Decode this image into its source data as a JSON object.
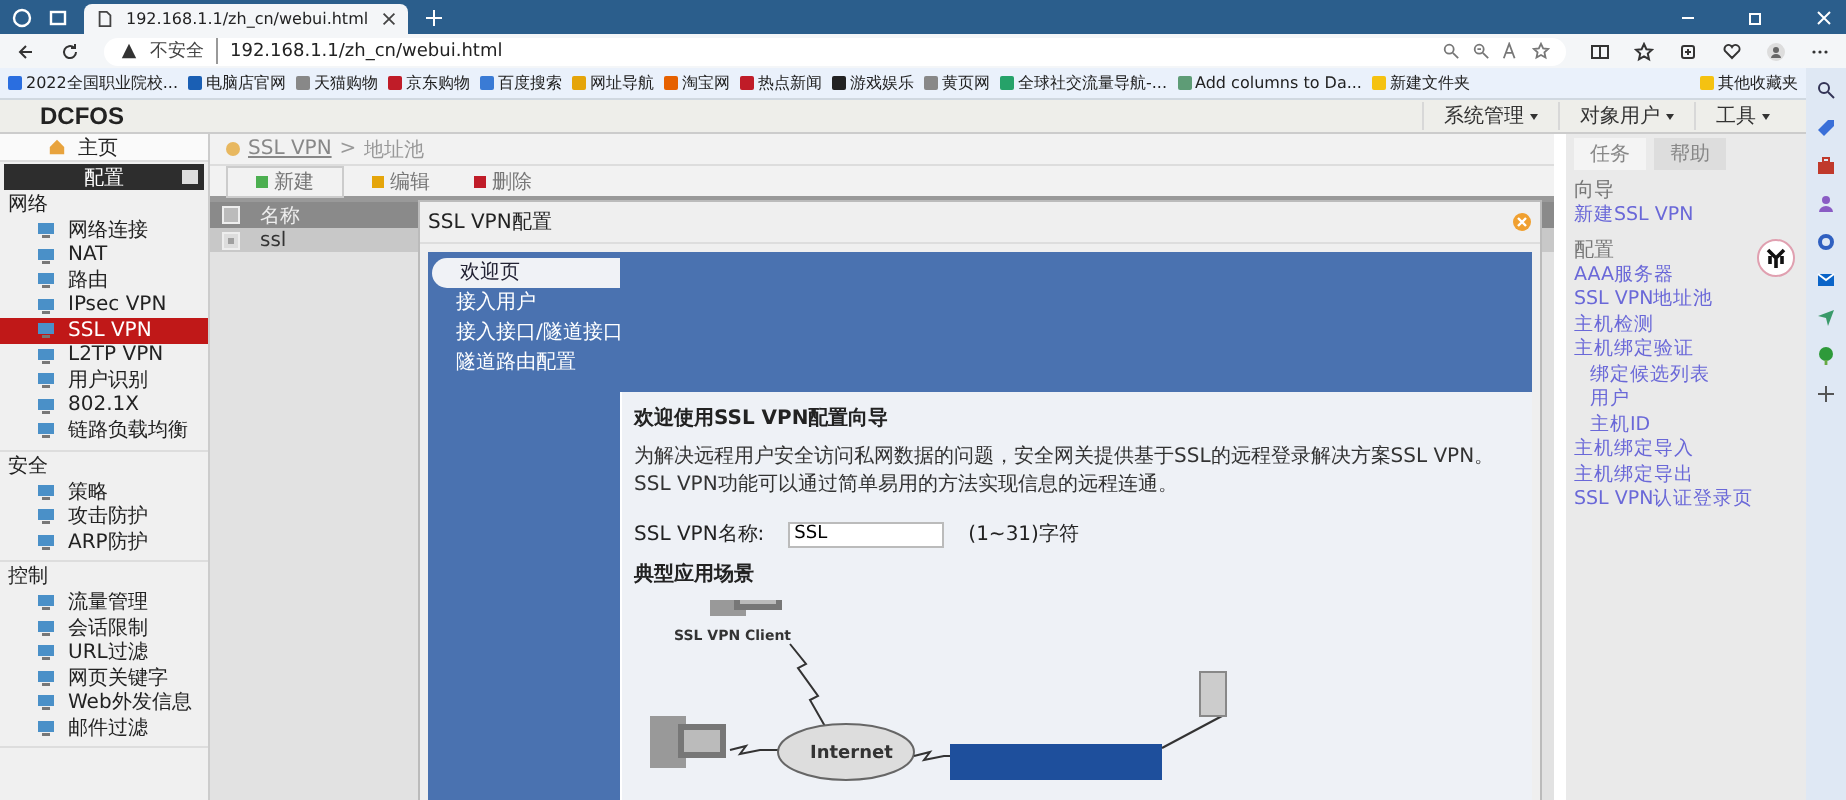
{
  "browser": {
    "tab_title": "192.168.1.1/zh_cn/webui.html",
    "security": "不安全",
    "url": "192.168.1.1/zh_cn/webui.html",
    "bookmarks": [
      "2022全国职业院校...",
      "电脑店官网",
      "天猫购物",
      "京东购物",
      "百度搜索",
      "网址导航",
      "淘宝网",
      "热点新闻",
      "游戏娱乐",
      "黄页网",
      "全球社交流量导航-...",
      "Add columns to Da...",
      "新建文件夹"
    ],
    "other_bookmarks": "其他收藏夹"
  },
  "app": {
    "logo": "DCFOS",
    "menus": [
      "系统管理",
      "对象用户",
      "工具"
    ]
  },
  "sidebar": {
    "home": "主页",
    "config": "配置",
    "sections": [
      {
        "title": "网络",
        "items": [
          {
            "label": "网络连接",
            "selected": false
          },
          {
            "label": "NAT",
            "selected": false
          },
          {
            "label": "路由",
            "selected": false
          },
          {
            "label": "IPsec VPN",
            "selected": false
          },
          {
            "label": "SSL VPN",
            "selected": true
          },
          {
            "label": "L2TP VPN",
            "selected": false
          },
          {
            "label": "用户识别",
            "selected": false
          },
          {
            "label": "802.1X",
            "selected": false
          },
          {
            "label": "链路负载均衡",
            "selected": false
          }
        ]
      },
      {
        "title": "安全",
        "items": [
          {
            "label": "策略",
            "selected": false
          },
          {
            "label": "攻击防护",
            "selected": false
          },
          {
            "label": "ARP防护",
            "selected": false
          }
        ]
      },
      {
        "title": "控制",
        "items": [
          {
            "label": "流量管理",
            "selected": false
          },
          {
            "label": "会话限制",
            "selected": false
          },
          {
            "label": "URL过滤",
            "selected": false
          },
          {
            "label": "网页关键字",
            "selected": false
          },
          {
            "label": "Web外发信息",
            "selected": false
          },
          {
            "label": "邮件过滤",
            "selected": false
          }
        ]
      }
    ]
  },
  "breadcrumb": {
    "link": "SSL VPN",
    "separator": ">",
    "current": "地址池"
  },
  "toolbar": [
    "新建",
    "编辑",
    "删除"
  ],
  "table": {
    "header": {
      "label": "名称",
      "checked": false
    },
    "rows": [
      {
        "name": "ssl",
        "checked": true
      }
    ]
  },
  "dialog": {
    "title": "SSL VPN配置",
    "steps": [
      {
        "label": "欢迎页",
        "selected": true
      },
      {
        "label": "接入用户",
        "selected": false
      },
      {
        "label": "接入接口/隧道接口",
        "selected": false
      },
      {
        "label": "隧道路由配置",
        "selected": false
      }
    ],
    "heading": "欢迎使用SSL VPN配置向导",
    "description": "为解决远程用户安全访问私网数据的问题，安全网关提供基于SSL的远程登录解决方案SSL VPN。SSL VPN功能可以通过简单易用的方法实现信息的远程连通。",
    "field": {
      "label": "SSL VPN名称:",
      "value": "SSL",
      "hint": "(1~31)字符"
    },
    "scenario_title": "典型应用场景",
    "diagram_labels": [
      "SSL VPN Client",
      "Internet"
    ]
  },
  "tasks": {
    "tabs": [
      {
        "label": "任务",
        "selected": true
      },
      {
        "label": "帮助",
        "selected": false
      }
    ],
    "groups": [
      {
        "title": "向导",
        "items": [
          {
            "label": "新建SSL VPN"
          }
        ]
      },
      {
        "title": "配置",
        "items": [
          {
            "label": "AAA服务器"
          },
          {
            "label": "SSL VPN地址池"
          },
          {
            "label": "主机检测"
          },
          {
            "label": "主机绑定验证",
            "children": [
              {
                "label": "绑定候选列表"
              },
              {
                "label": "用户"
              },
              {
                "label": "主机ID"
              }
            ]
          },
          {
            "label": "主机绑定导入"
          },
          {
            "label": "主机绑定导出"
          },
          {
            "label": "SSL VPN认证登录页"
          }
        ]
      }
    ]
  }
}
